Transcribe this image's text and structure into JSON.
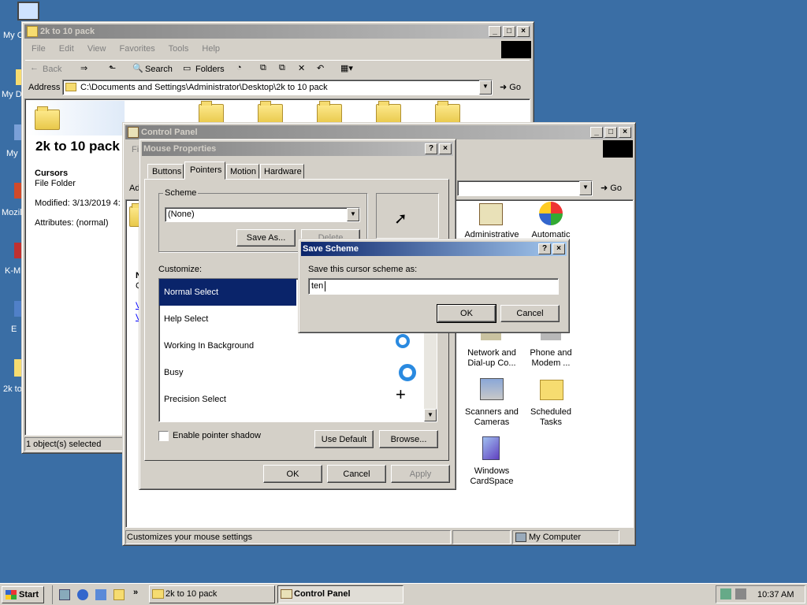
{
  "desktop": {
    "icons": [
      "My C",
      "My D",
      "My",
      "Mozil",
      "K-M",
      "E",
      "2k to"
    ]
  },
  "explorer": {
    "title": "2k to 10 pack",
    "menu": [
      "File",
      "Edit",
      "View",
      "Favorites",
      "Tools",
      "Help"
    ],
    "toolbar": {
      "back": "Back",
      "search": "Search",
      "folders": "Folders"
    },
    "address_label": "Address",
    "address_value": "C:\\Documents and Settings\\Administrator\\Desktop\\2k to 10 pack",
    "go": "Go",
    "folder_title": "2k to 10 pack",
    "info": {
      "name": "Cursors",
      "type": "File Folder",
      "modified": "Modified: 3/13/2019 4:",
      "attributes": "Attributes: (normal)"
    },
    "status": "1 object(s) selected"
  },
  "control_panel": {
    "title": "Control Panel",
    "menu_first": "Fi",
    "address_first": "Ad",
    "go": "Go",
    "left_chars": [
      "N",
      "C",
      "V",
      "V"
    ],
    "icons": [
      {
        "label": "Administrative",
        "icon": "admin-tools-icon"
      },
      {
        "label": "Automatic",
        "icon": "windows-update-icon"
      },
      {
        "label": "Network and Dial-up Co...",
        "icon": "network-icon"
      },
      {
        "label": "Phone and Modem ...",
        "icon": "phone-icon"
      },
      {
        "label": "Scanners and Cameras",
        "icon": "scanner-icon"
      },
      {
        "label": "Scheduled Tasks",
        "icon": "scheduled-tasks-icon"
      },
      {
        "label": "Windows CardSpace",
        "icon": "cardspace-icon"
      }
    ],
    "status": "Customizes your mouse settings",
    "status_right": "My Computer"
  },
  "mouse": {
    "title": "Mouse Properties",
    "tabs": [
      "Buttons",
      "Pointers",
      "Motion",
      "Hardware"
    ],
    "active_tab": "Pointers",
    "scheme_label": "Scheme",
    "scheme_value": "(None)",
    "save_as": "Save As...",
    "delete": "Delete",
    "customize_label": "Customize:",
    "items": [
      "Normal Select",
      "Help Select",
      "Working In Background",
      "Busy",
      "Precision Select"
    ],
    "shadow_label": "Enable pointer shadow",
    "use_default": "Use Default",
    "browse": "Browse...",
    "ok": "OK",
    "cancel": "Cancel",
    "apply": "Apply"
  },
  "save_scheme": {
    "title": "Save Scheme",
    "prompt": "Save this cursor scheme as:",
    "value": "ten",
    "ok": "OK",
    "cancel": "Cancel"
  },
  "taskbar": {
    "start": "Start",
    "tasks": [
      "2k to 10 pack",
      "Control Panel"
    ],
    "clock": "10:37 AM"
  }
}
